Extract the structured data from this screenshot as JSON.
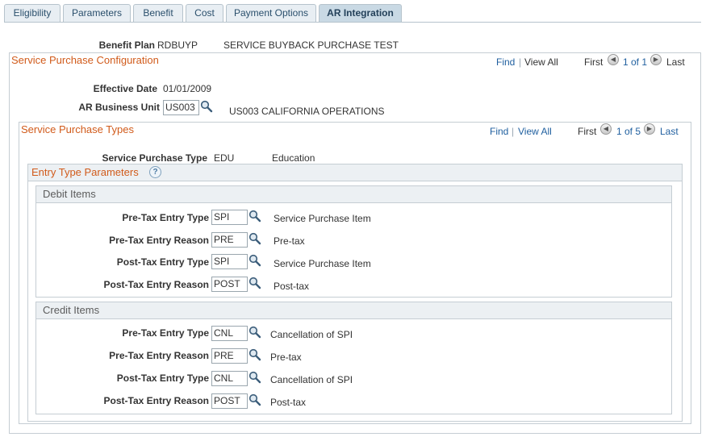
{
  "tabs": [
    {
      "label": "Eligibility"
    },
    {
      "label": "Parameters"
    },
    {
      "label": "Benefit"
    },
    {
      "label": "Cost"
    },
    {
      "label": "Payment Options"
    },
    {
      "label": "AR Integration"
    }
  ],
  "benefit_plan": {
    "label": "Benefit Plan",
    "code": "RDBUYP",
    "desc": "SERVICE BUYBACK PURCHASE TEST"
  },
  "config": {
    "title": "Service Purchase Configuration",
    "nav": {
      "find": "Find",
      "sep": "|",
      "view_all": "View All",
      "first": "First",
      "counter": "1 of 1",
      "last": "Last"
    },
    "effective_date_label": "Effective Date",
    "effective_date": "01/01/2009",
    "ar_bu_label": "AR Business Unit",
    "ar_bu_value": "US003",
    "ar_bu_desc": "US003 CALIFORNIA OPERATIONS"
  },
  "types": {
    "title": "Service Purchase Types",
    "nav": {
      "find": "Find",
      "sep": "|",
      "view_all": "View All",
      "first": "First",
      "counter": "1 of 5",
      "last": "Last"
    },
    "type_label": "Service Purchase Type",
    "type_code": "EDU",
    "type_desc": "Education"
  },
  "entry": {
    "title": "Entry Type Parameters",
    "help": "?"
  },
  "debit": {
    "title": "Debit Items",
    "rows": [
      {
        "label": "Pre-Tax Entry Type",
        "value": "SPI",
        "desc": "Service Purchase Item"
      },
      {
        "label": "Pre-Tax Entry Reason",
        "value": "PRE",
        "desc": "Pre-tax"
      },
      {
        "label": "Post-Tax Entry Type",
        "value": "SPI",
        "desc": "Service Purchase Item"
      },
      {
        "label": "Post-Tax Entry Reason",
        "value": "POST",
        "desc": "Post-tax"
      }
    ]
  },
  "credit": {
    "title": "Credit Items",
    "rows": [
      {
        "label": "Pre-Tax Entry Type",
        "value": "CNL",
        "desc": "Cancellation of SPI"
      },
      {
        "label": "Pre-Tax Entry Reason",
        "value": "PRE",
        "desc": "Pre-tax"
      },
      {
        "label": "Post-Tax Entry Type",
        "value": "CNL",
        "desc": "Cancellation of SPI"
      },
      {
        "label": "Post-Tax Entry Reason",
        "value": "POST",
        "desc": "Post-tax"
      }
    ]
  }
}
